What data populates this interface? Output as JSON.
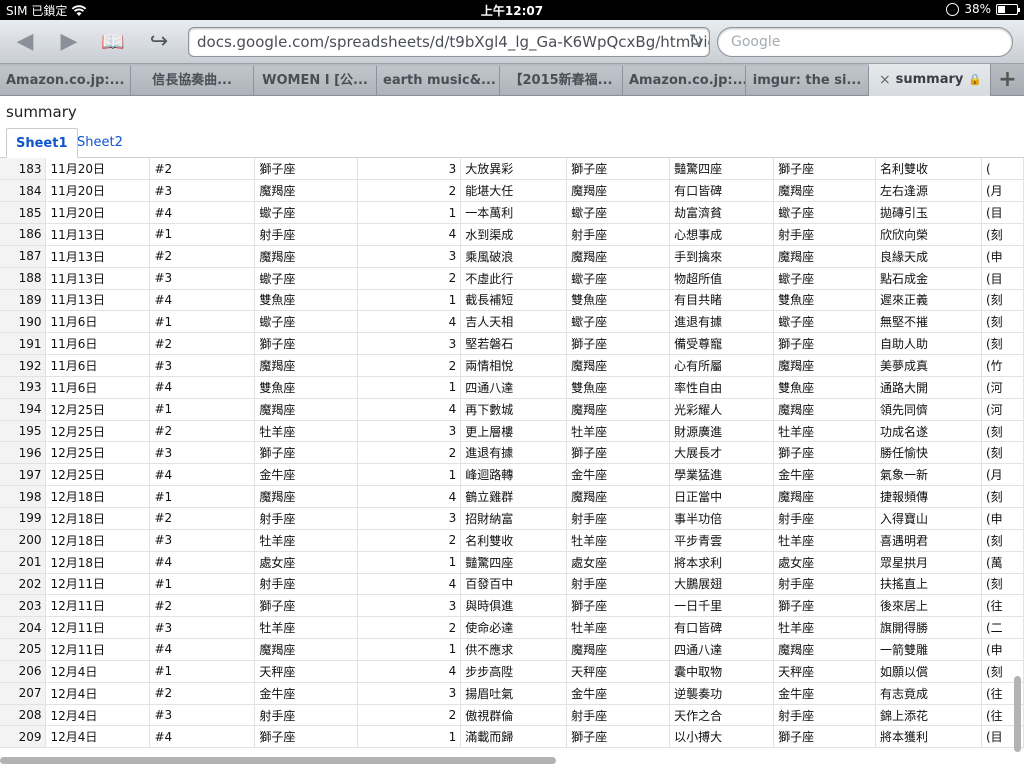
{
  "status": {
    "carrier": "SIM 已鎖定",
    "time": "上午12:07",
    "battery": "38%",
    "battery_level": 0.38
  },
  "toolbar": {
    "back": "◀",
    "forward": "▶",
    "bookmarks": "📖",
    "share": "↪",
    "url": "docs.google.com/spreadsheets/d/t9bXgl4_lg_Ga-K6WpQcxBg/htmlview?p",
    "reload": "↻",
    "search_placeholder": "Google"
  },
  "tabs": [
    "Amazon.co.jp:...",
    "信長協奏曲...",
    "WOMEN I [公...",
    "earth music&...",
    "【2015新春福...",
    "Amazon.co.jp:...",
    "imgur: the si...",
    "summary"
  ],
  "tab_close": "×",
  "new_tab": "+",
  "doc": {
    "title": "summary",
    "sheets": [
      "Sheet1",
      "Sheet2"
    ]
  },
  "rows": [
    [
      "183",
      "11月20日",
      "#2",
      "獅子座",
      "3",
      "大放異彩",
      "獅子座",
      "豔驚四座",
      "獅子座",
      "名利雙收",
      "("
    ],
    [
      "184",
      "11月20日",
      "#3",
      "魔羯座",
      "2",
      "能堪大任",
      "魔羯座",
      "有口皆碑",
      "魔羯座",
      "左右逢源",
      "(月"
    ],
    [
      "185",
      "11月20日",
      "#4",
      "蠍子座",
      "1",
      "一本萬利",
      "蠍子座",
      "劫富濟貧",
      "蠍子座",
      "拋磚引玉",
      "(目"
    ],
    [
      "186",
      "11月13日",
      "#1",
      "射手座",
      "4",
      "水到渠成",
      "射手座",
      "心想事成",
      "射手座",
      "欣欣向榮",
      "(刻"
    ],
    [
      "187",
      "11月13日",
      "#2",
      "魔羯座",
      "3",
      "乘風破浪",
      "魔羯座",
      "手到擒來",
      "魔羯座",
      "良緣天成",
      "(申"
    ],
    [
      "188",
      "11月13日",
      "#3",
      "蠍子座",
      "2",
      "不虛此行",
      "蠍子座",
      "物超所值",
      "蠍子座",
      "點石成金",
      "(目"
    ],
    [
      "189",
      "11月13日",
      "#4",
      "雙魚座",
      "1",
      "截長補短",
      "雙魚座",
      "有目共睹",
      "雙魚座",
      "遲來正義",
      "(刻"
    ],
    [
      "190",
      "11月6日",
      "#1",
      "蠍子座",
      "4",
      "吉人天相",
      "蠍子座",
      "進退有據",
      "蠍子座",
      "無堅不摧",
      "(刻"
    ],
    [
      "191",
      "11月6日",
      "#2",
      "獅子座",
      "3",
      "堅若磐石",
      "獅子座",
      "備受尊寵",
      "獅子座",
      "自助人助",
      "(刻"
    ],
    [
      "192",
      "11月6日",
      "#3",
      "魔羯座",
      "2",
      "兩情相悅",
      "魔羯座",
      "心有所屬",
      "魔羯座",
      "美夢成真",
      "(竹"
    ],
    [
      "193",
      "11月6日",
      "#4",
      "雙魚座",
      "1",
      "四通八達",
      "雙魚座",
      "率性自由",
      "雙魚座",
      "通路大開",
      "(河"
    ],
    [
      "194",
      "12月25日",
      "#1",
      "魔羯座",
      "4",
      "再下數城",
      "魔羯座",
      "光彩耀人",
      "魔羯座",
      "領先同儕",
      "(河"
    ],
    [
      "195",
      "12月25日",
      "#2",
      "牡羊座",
      "3",
      "更上層樓",
      "牡羊座",
      "財源廣進",
      "牡羊座",
      "功成名遂",
      "(刻"
    ],
    [
      "196",
      "12月25日",
      "#3",
      "獅子座",
      "2",
      "進退有據",
      "獅子座",
      "大展長才",
      "獅子座",
      "勝任愉快",
      "(刻"
    ],
    [
      "197",
      "12月25日",
      "#4",
      "金牛座",
      "1",
      "峰迴路轉",
      "金牛座",
      "學業猛進",
      "金牛座",
      "氣象一新",
      "(月"
    ],
    [
      "198",
      "12月18日",
      "#1",
      "魔羯座",
      "4",
      "鶴立雞群",
      "魔羯座",
      "日正當中",
      "魔羯座",
      "捷報頻傳",
      "(刻"
    ],
    [
      "199",
      "12月18日",
      "#2",
      "射手座",
      "3",
      "招財納富",
      "射手座",
      "事半功倍",
      "射手座",
      "入得寶山",
      "(申"
    ],
    [
      "200",
      "12月18日",
      "#3",
      "牡羊座",
      "2",
      "名利雙收",
      "牡羊座",
      "平步青雲",
      "牡羊座",
      "喜遇明君",
      "(刻"
    ],
    [
      "201",
      "12月18日",
      "#4",
      "處女座",
      "1",
      "豔驚四座",
      "處女座",
      "將本求利",
      "處女座",
      "眾星拱月",
      "(萬"
    ],
    [
      "202",
      "12月11日",
      "#1",
      "射手座",
      "4",
      "百發百中",
      "射手座",
      "大鵬展翅",
      "射手座",
      "扶搖直上",
      "(刻"
    ],
    [
      "203",
      "12月11日",
      "#2",
      "獅子座",
      "3",
      "與時俱進",
      "獅子座",
      "一日千里",
      "獅子座",
      "後來居上",
      "(往"
    ],
    [
      "204",
      "12月11日",
      "#3",
      "牡羊座",
      "2",
      "使命必達",
      "牡羊座",
      "有口皆碑",
      "牡羊座",
      "旗開得勝",
      "(二"
    ],
    [
      "205",
      "12月11日",
      "#4",
      "魔羯座",
      "1",
      "供不應求",
      "魔羯座",
      "四通八達",
      "魔羯座",
      "一箭雙雕",
      "(申"
    ],
    [
      "206",
      "12月4日",
      "#1",
      "天秤座",
      "4",
      "步步高陞",
      "天秤座",
      "囊中取物",
      "天秤座",
      "如願以償",
      "(刻"
    ],
    [
      "207",
      "12月4日",
      "#2",
      "金牛座",
      "3",
      "揚眉吐氣",
      "金牛座",
      "逆襲奏功",
      "金牛座",
      "有志竟成",
      "(往"
    ],
    [
      "208",
      "12月4日",
      "#3",
      "射手座",
      "2",
      "傲視群倫",
      "射手座",
      "天作之合",
      "射手座",
      "錦上添花",
      "(往"
    ],
    [
      "209",
      "12月4日",
      "#4",
      "獅子座",
      "1",
      "滿載而歸",
      "獅子座",
      "以小搏大",
      "獅子座",
      "將本獲利",
      "(目"
    ]
  ]
}
